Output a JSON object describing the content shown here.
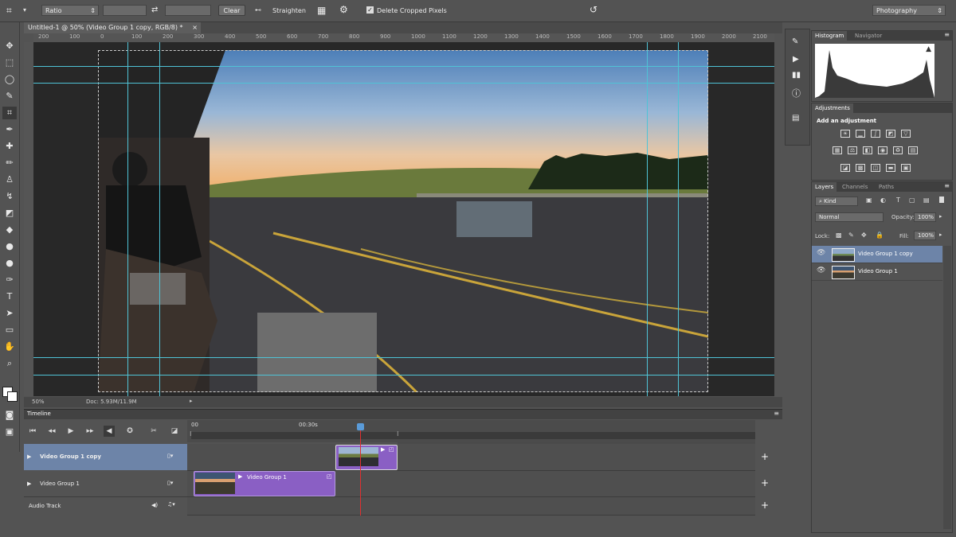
{
  "options_bar": {
    "ratio_select": "Ratio",
    "clear_button": "Clear",
    "straighten_label": "Straighten",
    "delete_cropped_label": "Delete Cropped Pixels",
    "workspace_select": "Photography"
  },
  "document": {
    "tab_title": "Untitled-1 @ 50% (Video Group 1 copy, RGB/8) *",
    "zoom": "50%",
    "doc_size": "Doc: 5.93M/11.9M",
    "ruler_labels": [
      "200",
      "100",
      "0",
      "100",
      "200",
      "300",
      "400",
      "500",
      "600",
      "700",
      "800",
      "900",
      "1000",
      "1100",
      "1200",
      "1300",
      "1400",
      "1500",
      "1600",
      "1700",
      "1800",
      "1900",
      "2000",
      "2100"
    ]
  },
  "timeline": {
    "title": "Timeline",
    "time_mark": "00:30s",
    "start_mark": "00",
    "tracks": [
      {
        "name": "Video Group 1 copy"
      },
      {
        "name": "Video Group 1",
        "clip_label": "Video Group 1"
      },
      {
        "name": "Audio Track"
      }
    ]
  },
  "panels": {
    "histogram_tab": "Histogram",
    "navigator_tab": "Navigator",
    "adjustments_tab": "Adjustments",
    "add_adjustment": "Add an adjustment",
    "layers_tab": "Layers",
    "channels_tab": "Channels",
    "paths_tab": "Paths",
    "kind_filter": "Kind",
    "blend_mode": "Normal",
    "opacity_label": "Opacity:",
    "opacity_value": "100%",
    "lock_label": "Lock:",
    "fill_label": "Fill:",
    "fill_value": "100%",
    "layers": [
      {
        "name": "Video Group 1 copy",
        "selected": true
      },
      {
        "name": "Video Group 1",
        "selected": false
      }
    ]
  },
  "colors": {
    "guide": "#4fc3d6",
    "clip": "#8a5fc4",
    "playhead": "#e03030",
    "selected_row": "#6d84a8"
  }
}
